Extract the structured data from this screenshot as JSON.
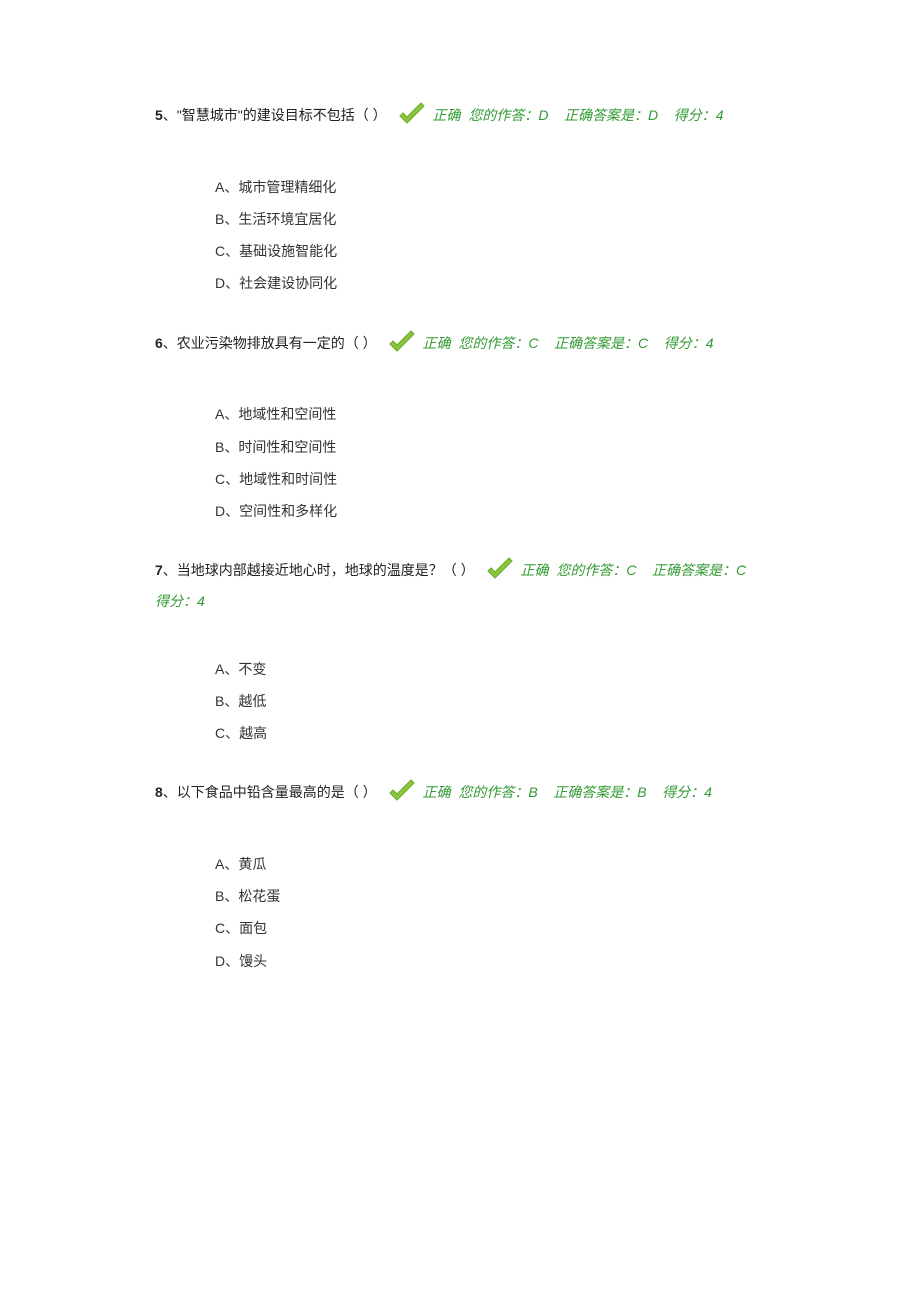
{
  "questions": [
    {
      "number": "5",
      "sep": "、",
      "text": "\"智慧城市\"的建设目标不包括（ ）",
      "status": "正确",
      "your_answer_label": "您的作答：",
      "your_answer": "D",
      "correct_label": "正确答案是：",
      "correct_answer": "D",
      "score_label": "得分：",
      "score": "4",
      "options": [
        "A、城市管理精细化",
        "B、生活环境宜居化",
        "C、基础设施智能化",
        "D、社会建设协同化"
      ]
    },
    {
      "number": "6",
      "sep": "、",
      "text": "农业污染物排放具有一定的（ ）",
      "status": "正确",
      "your_answer_label": "您的作答：",
      "your_answer": "C",
      "correct_label": "正确答案是：",
      "correct_answer": "C",
      "score_label": "得分：",
      "score": "4",
      "options": [
        "A、地域性和空间性",
        "B、时间性和空间性",
        "C、地域性和时间性",
        "D、空间性和多样化"
      ]
    },
    {
      "number": "7",
      "sep": "、",
      "text": "当地球内部越接近地心时，地球的温度是？（ ）",
      "status": "正确",
      "your_answer_label": "您的作答：",
      "your_answer": "C",
      "correct_label": "正确答案是：",
      "correct_answer": "C",
      "score_label": "得分：",
      "score": "4",
      "options": [
        "A、不变",
        "B、越低",
        "C、越高"
      ]
    },
    {
      "number": "8",
      "sep": "、",
      "text": "以下食品中铅含量最高的是（ ）",
      "status": "正确",
      "your_answer_label": "您的作答：",
      "your_answer": "B",
      "correct_label": "正确答案是：",
      "correct_answer": "B",
      "score_label": "得分：",
      "score": "4",
      "options": [
        "A、黄瓜",
        "B、松花蛋",
        "C、面包",
        "D、馒头"
      ]
    }
  ]
}
